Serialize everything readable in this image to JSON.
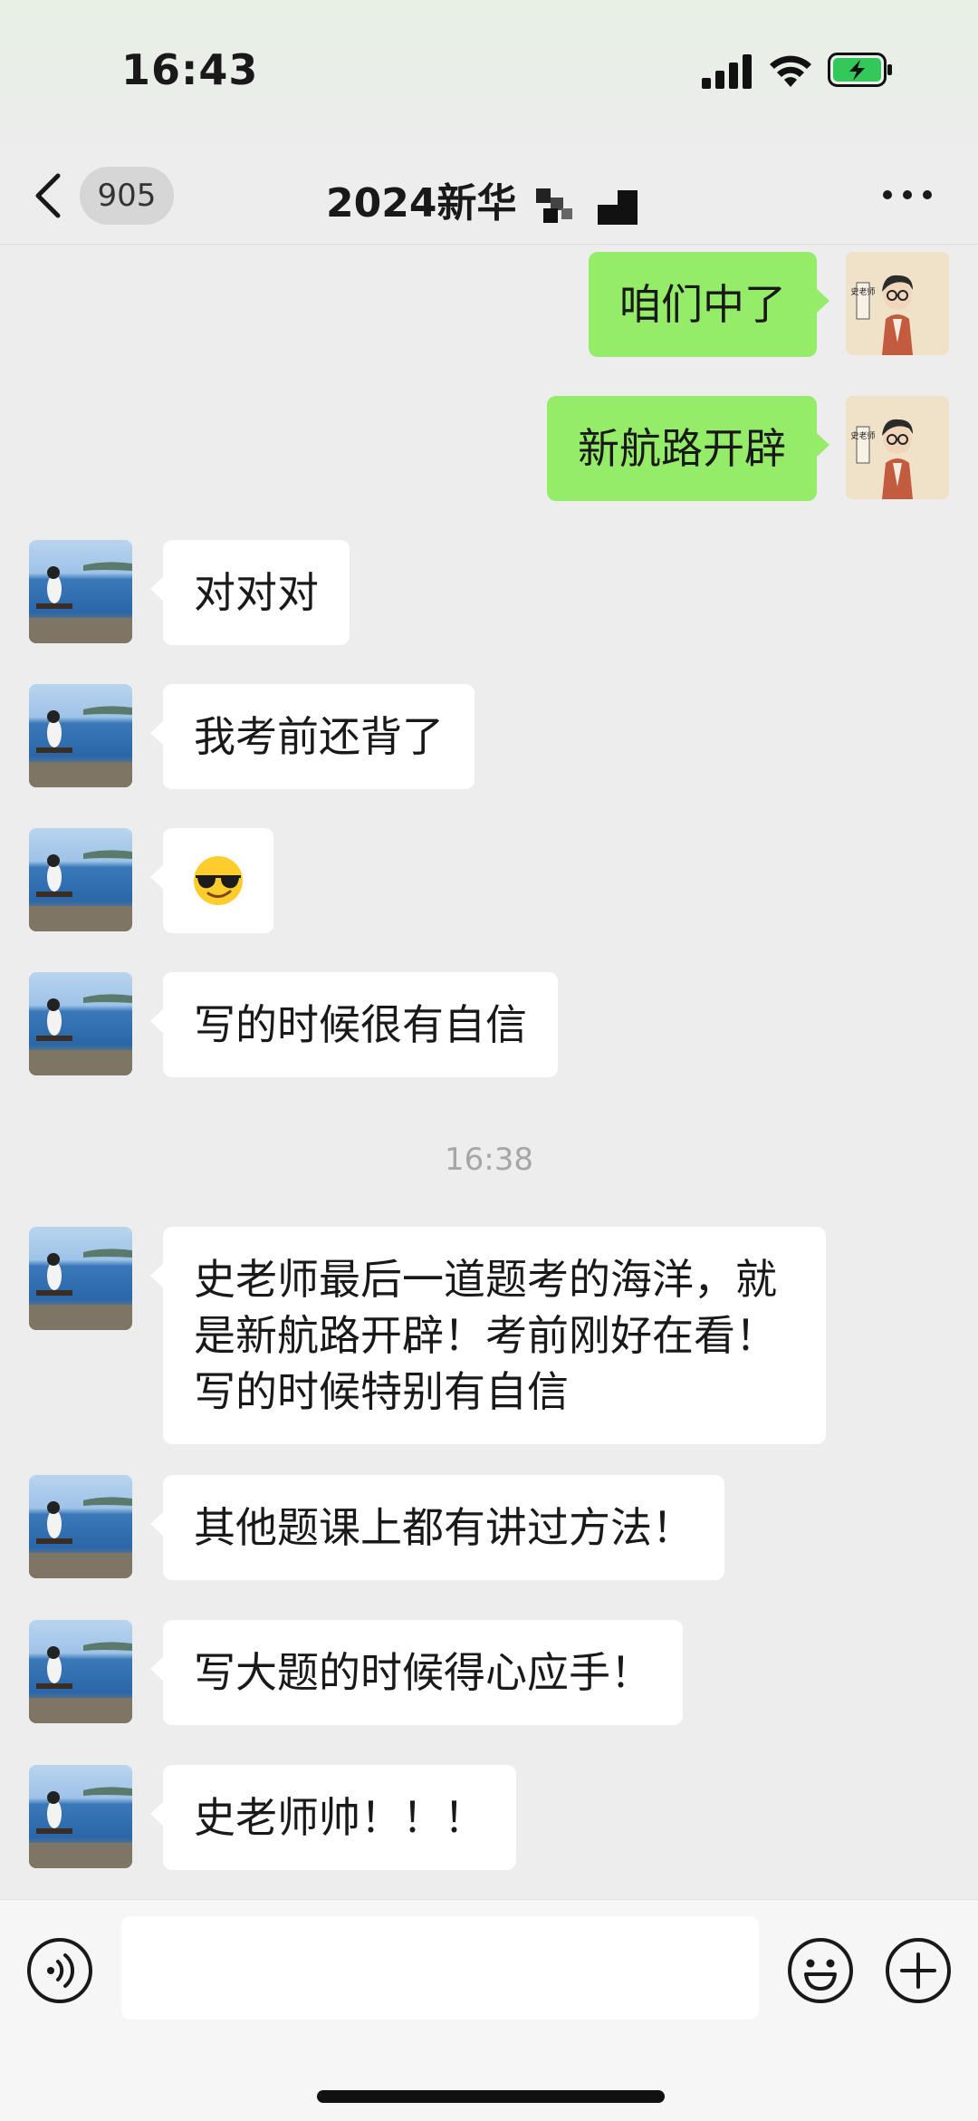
{
  "status_bar": {
    "time": "16:43",
    "icons": [
      "cellular-signal-icon",
      "wifi-icon",
      "battery-charging-icon"
    ],
    "battery_color": "#34c759"
  },
  "nav": {
    "back_icon": "chevron-left-icon",
    "unread_count": "905",
    "title": "2024新华",
    "more_icon": "more-dots-icon"
  },
  "messages": [
    {
      "side": "out",
      "sender": "teacher",
      "text": "咱们中了"
    },
    {
      "side": "out",
      "sender": "teacher",
      "text": "新航路开辟"
    },
    {
      "side": "in",
      "sender": "student",
      "text": "对对对"
    },
    {
      "side": "in",
      "sender": "student",
      "text": "我考前还背了"
    },
    {
      "side": "in",
      "sender": "student",
      "text": "😎"
    },
    {
      "side": "in",
      "sender": "student",
      "text": "写的时候很有自信"
    },
    {
      "side": "in",
      "sender": "student",
      "text": "史老师最后一道题考的海洋，就是新航路开辟！考前刚好在看！写的时候特别有自信"
    },
    {
      "side": "in",
      "sender": "student",
      "text": "其他题课上都有讲过方法！"
    },
    {
      "side": "in",
      "sender": "student",
      "text": "写大题的时候得心应手！"
    },
    {
      "side": "in",
      "sender": "student",
      "text": "史老师帅！！！"
    }
  ],
  "timestamp": "16:38",
  "teacher_avatar": {
    "label": "史老师"
  },
  "input_bar": {
    "placeholder": "",
    "voice_icon": "voice-icon",
    "emoji_icon": "emoji-icon",
    "plus_icon": "plus-icon"
  },
  "colors": {
    "background": "#ededed",
    "outgoing_bubble": "#95ec69",
    "incoming_bubble": "#ffffff"
  }
}
